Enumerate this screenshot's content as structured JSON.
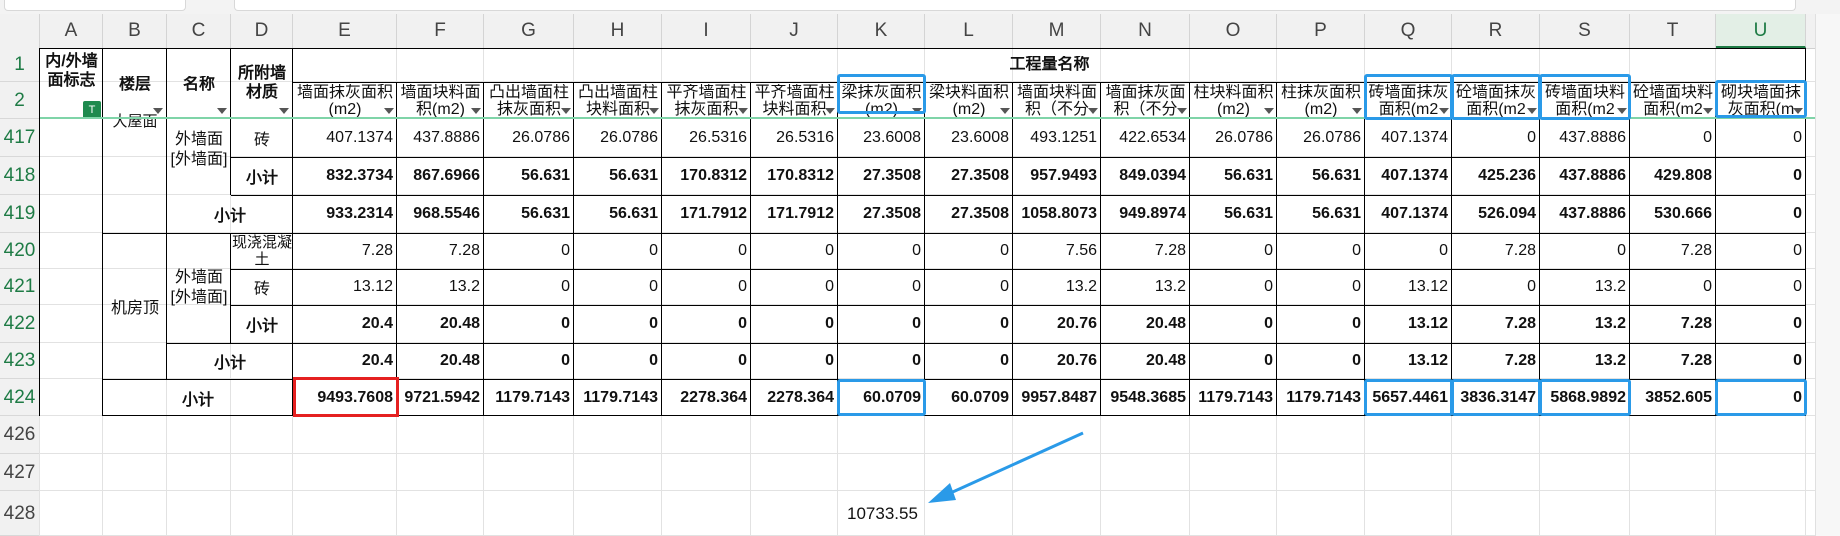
{
  "columns": [
    "A",
    "B",
    "C",
    "D",
    "E",
    "F",
    "G",
    "H",
    "I",
    "J",
    "K",
    "L",
    "M",
    "N",
    "O",
    "P",
    "Q",
    "R",
    "S",
    "T",
    "U"
  ],
  "selected_column": "U",
  "header": {
    "a": "内/外墙面标志",
    "b": "楼层",
    "c": "名称",
    "d": "所附墙材质",
    "group_title": "工程量名称",
    "measure_headers": [
      "墙面抹灰面积(m2)",
      "墙面块料面积(m2)",
      "凸出墙面柱抹灰面积",
      "凸出墙面柱块料面积",
      "平齐墙面柱抹灰面积",
      "平齐墙面柱块料面积",
      "梁抹灰面积(m2)",
      "梁块料面积(m2)",
      "墙面块料面积（不分",
      "墙面抹灰面积（不分",
      "柱块料面积(m2)",
      "柱抹灰面积(m2)",
      "砖墙面抹灰面积(m2",
      "砼墙面抹灰面积(m2",
      "砖墙面块料面积(m2",
      "砼墙面块料面积(m2",
      "砌块墙面抹灰面积(m"
    ]
  },
  "row_numbers": [
    "1",
    "2",
    "417",
    "418",
    "419",
    "420",
    "421",
    "422",
    "423",
    "424",
    "426",
    "427",
    "428"
  ],
  "left_labels": {
    "floor_top": "大屋面",
    "name_top": "外墙面[外墙面]",
    "mat_417": "砖",
    "subtotal": "小计",
    "floor_machine": "机房顶",
    "name_machine": "外墙面[外墙面]",
    "mat_420": "现浇混凝土",
    "mat_421": "砖"
  },
  "rows": {
    "r417": [
      "407.1374",
      "437.8886",
      "26.0786",
      "26.0786",
      "26.5316",
      "26.5316",
      "23.6008",
      "23.6008",
      "493.1251",
      "422.6534",
      "26.0786",
      "26.0786",
      "407.1374",
      "0",
      "437.8886",
      "0",
      "0"
    ],
    "r418": [
      "832.3734",
      "867.6966",
      "56.631",
      "56.631",
      "170.8312",
      "170.8312",
      "27.3508",
      "27.3508",
      "957.9493",
      "849.0394",
      "56.631",
      "56.631",
      "407.1374",
      "425.236",
      "437.8886",
      "429.808",
      "0"
    ],
    "r419": [
      "933.2314",
      "968.5546",
      "56.631",
      "56.631",
      "171.7912",
      "171.7912",
      "27.3508",
      "27.3508",
      "1058.8073",
      "949.8974",
      "56.631",
      "56.631",
      "407.1374",
      "526.094",
      "437.8886",
      "530.666",
      "0"
    ],
    "r420": [
      "7.28",
      "7.28",
      "0",
      "0",
      "0",
      "0",
      "0",
      "0",
      "7.56",
      "7.28",
      "0",
      "0",
      "0",
      "7.28",
      "0",
      "7.28",
      "0"
    ],
    "r421": [
      "13.12",
      "13.2",
      "0",
      "0",
      "0",
      "0",
      "0",
      "0",
      "13.2",
      "13.2",
      "0",
      "0",
      "13.12",
      "0",
      "13.2",
      "0",
      "0"
    ],
    "r422": [
      "20.4",
      "20.48",
      "0",
      "0",
      "0",
      "0",
      "0",
      "0",
      "20.76",
      "20.48",
      "0",
      "0",
      "13.12",
      "7.28",
      "13.2",
      "7.28",
      "0"
    ],
    "r423": [
      "20.4",
      "20.48",
      "0",
      "0",
      "0",
      "0",
      "0",
      "0",
      "20.76",
      "20.48",
      "0",
      "0",
      "13.12",
      "7.28",
      "13.2",
      "7.28",
      "0"
    ],
    "r424": [
      "9493.7608",
      "9721.5942",
      "1179.7143",
      "1179.7143",
      "2278.364",
      "2278.364",
      "60.0709",
      "60.0709",
      "9957.8487",
      "9548.3685",
      "1179.7143",
      "1179.7143",
      "5657.4461",
      "3836.3147",
      "5868.9892",
      "3852.605",
      "0"
    ]
  },
  "annotation_value": "10733.55",
  "filter_icon_label": "T",
  "colors": {
    "accent_green": "#1e7b45",
    "highlight_red": "#e52020",
    "highlight_blue": "#2a9ae8"
  }
}
